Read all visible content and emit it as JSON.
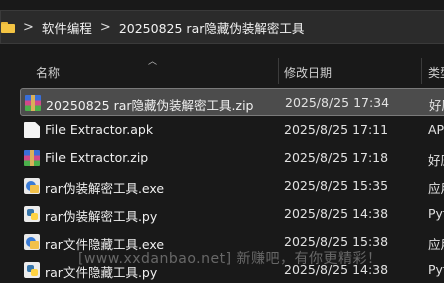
{
  "breadcrumb": {
    "items": [
      "软件编程",
      "20250825 rar隐藏伪装解密工具"
    ],
    "separator": ">"
  },
  "columns": {
    "name": "名称",
    "date": "修改日期",
    "type": "类型"
  },
  "files": [
    {
      "name": "20250825 rar隐藏伪装解密工具.zip",
      "date": "2025/8/25 17:34",
      "type": "好压",
      "icon": "winrar-archive-icon",
      "selected": true
    },
    {
      "name": "File Extractor.apk",
      "date": "2025/8/25 17:11",
      "type": "AP",
      "icon": "document-icon",
      "selected": false
    },
    {
      "name": "File Extractor.zip",
      "date": "2025/8/25 17:18",
      "type": "好压",
      "icon": "winrar-archive-icon",
      "selected": false
    },
    {
      "name": "rar伪装解密工具.exe",
      "date": "2025/8/25 15:35",
      "type": "应用",
      "icon": "exe-icon",
      "selected": false
    },
    {
      "name": "rar伪装解密工具.py",
      "date": "2025/8/25 14:38",
      "type": "Pyt",
      "icon": "python-icon",
      "selected": false
    },
    {
      "name": "rar文件隐藏工具.exe",
      "date": "2025/8/25 15:38",
      "type": "应用",
      "icon": "exe-icon",
      "selected": false
    },
    {
      "name": "rar文件隐藏工具.py",
      "date": "2025/8/25 14:38",
      "type": "Pyt",
      "icon": "python-icon",
      "selected": false
    }
  ],
  "watermark": "[www.xxdanbao.net] 新赚吧，有你更精彩！"
}
